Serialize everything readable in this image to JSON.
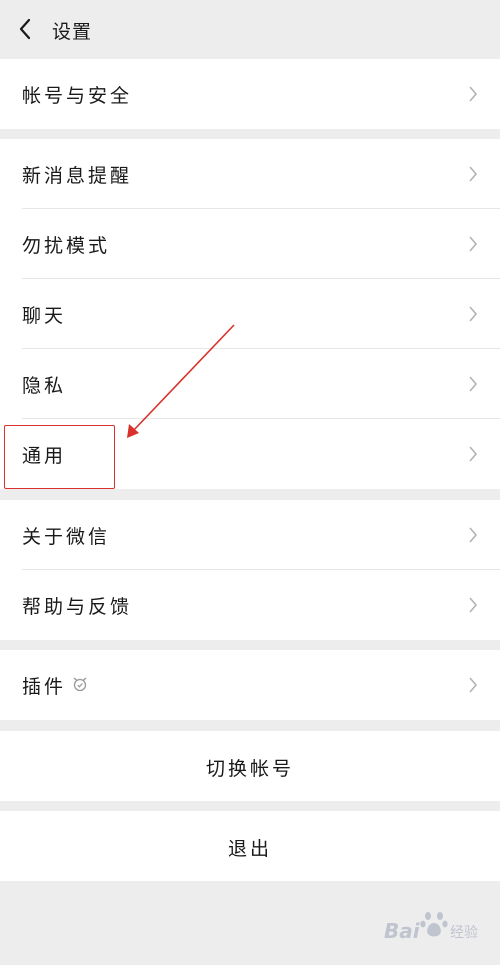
{
  "header": {
    "title": "设置"
  },
  "groups": [
    {
      "items": [
        {
          "label": "帐号与安全"
        }
      ]
    },
    {
      "items": [
        {
          "label": "新消息提醒"
        },
        {
          "label": "勿扰模式"
        },
        {
          "label": "聊天"
        },
        {
          "label": "隐私"
        },
        {
          "label": "通用"
        }
      ]
    },
    {
      "items": [
        {
          "label": "关于微信"
        },
        {
          "label": "帮助与反馈"
        }
      ]
    },
    {
      "items": [
        {
          "label": "插件"
        }
      ]
    }
  ],
  "actions": {
    "switch_account": "切换帐号",
    "logout": "退出"
  },
  "watermark": {
    "brand": "Bai",
    "sub": "经验"
  },
  "icons": {
    "back": "chevron-left-icon",
    "row_arrow": "chevron-right-icon",
    "plugin": "plugin-badge-icon"
  },
  "colors": {
    "background": "#ededed",
    "annotation": "#d9312b"
  }
}
